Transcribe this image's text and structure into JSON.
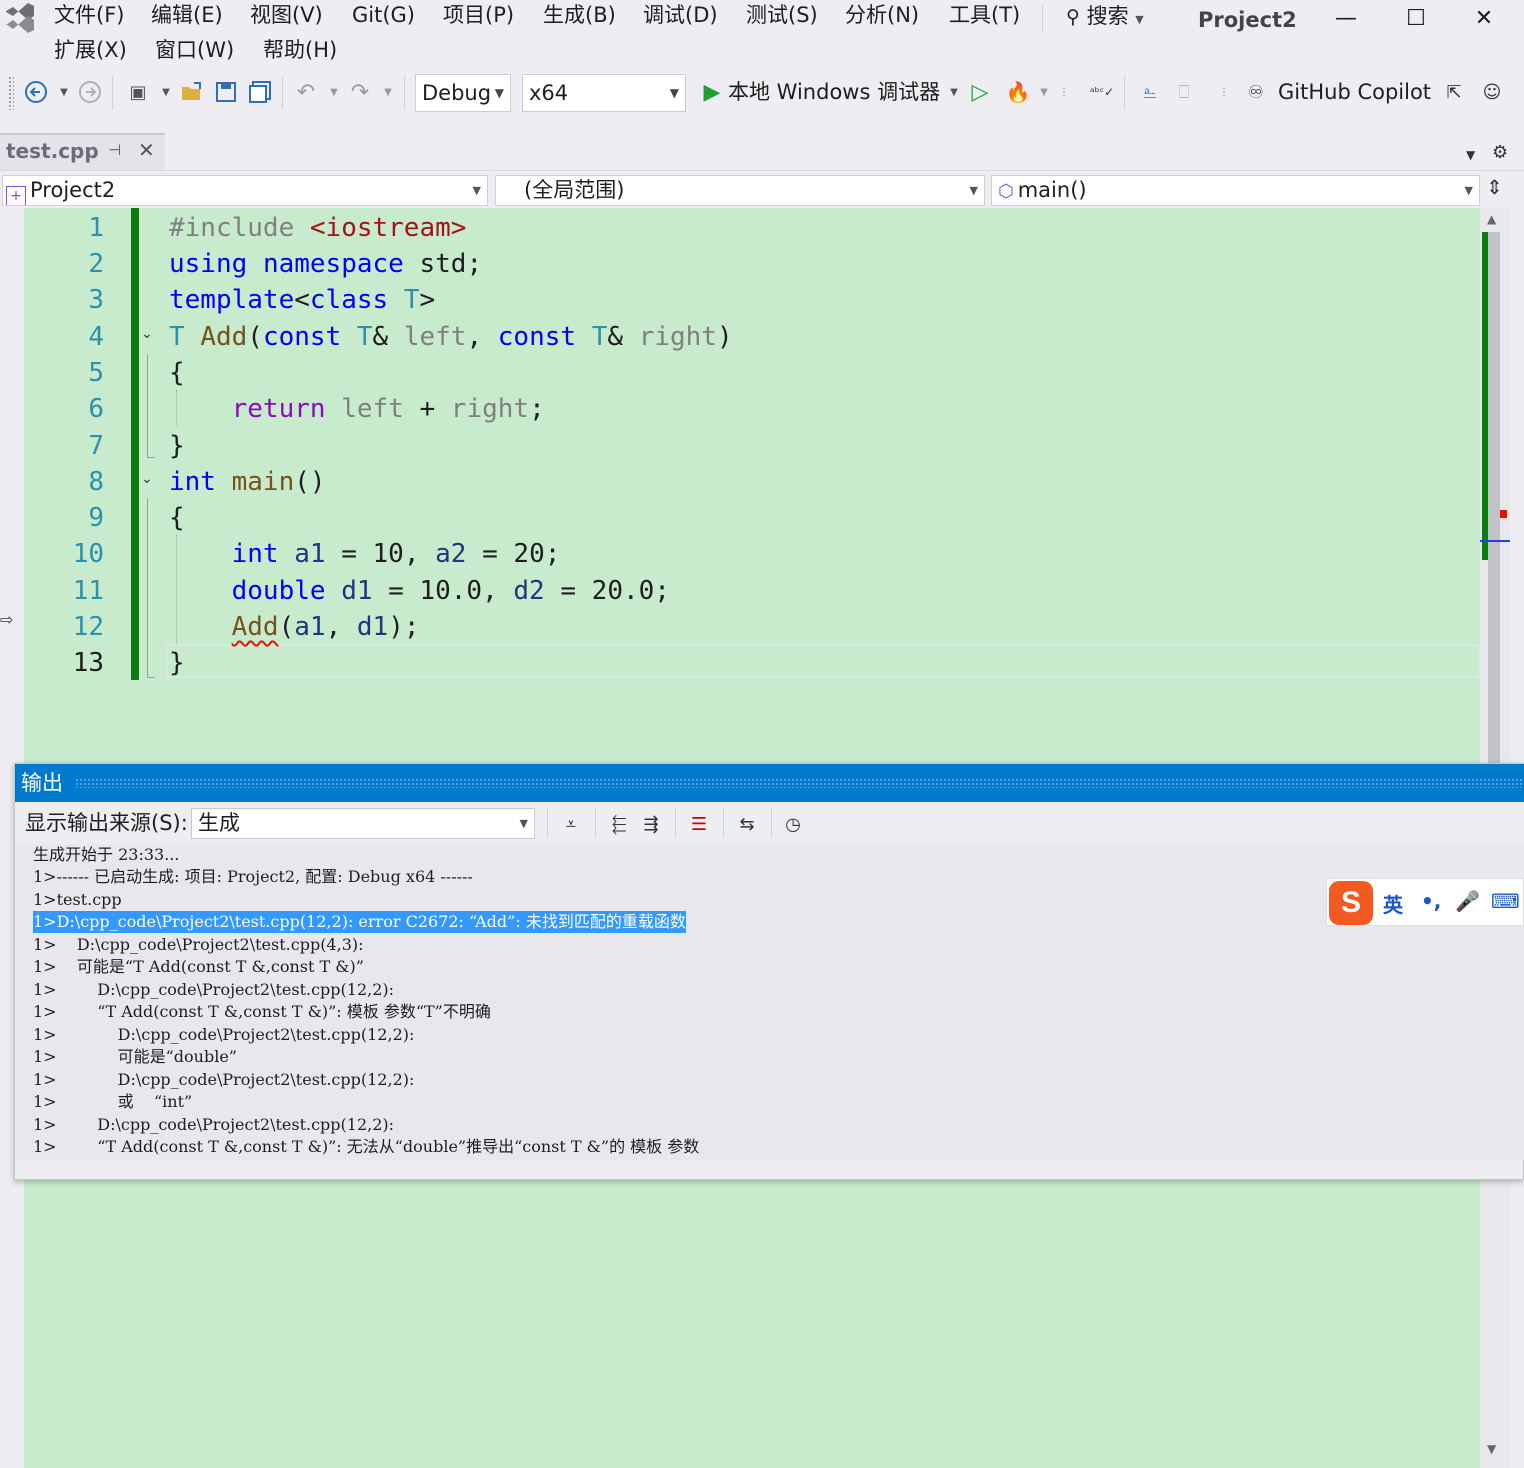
{
  "menu": {
    "row1": [
      "文件(F)",
      "编辑(E)",
      "视图(V)",
      "Git(G)",
      "项目(P)",
      "生成(B)",
      "调试(D)",
      "测试(S)",
      "分析(N)",
      "工具(T)"
    ],
    "row2": [
      "扩展(X)",
      "窗口(W)",
      "帮助(H)"
    ],
    "search_label": "搜索",
    "window_title": "Project2",
    "minimize": "—",
    "maximize": "☐",
    "close": "✕"
  },
  "toolbar": {
    "config": "Debug",
    "platform": "x64",
    "run_label": "本地 Windows 调试器",
    "copilot_label": "GitHub Copilot"
  },
  "tab": {
    "file_name": "test.cpp"
  },
  "navbar": {
    "project": "Project2",
    "scope": "(全局范围)",
    "member": "main()"
  },
  "editor": {
    "line_numbers": [
      "1",
      "2",
      "3",
      "4",
      "5",
      "6",
      "7",
      "8",
      "9",
      "10",
      "11",
      "12",
      "13"
    ],
    "current_line": 13
  },
  "output": {
    "title": "输出",
    "source_label": "显示输出来源(S):",
    "source_value": "生成",
    "lines": [
      "生成开始于 23:33...",
      "1>------ 已启动生成: 项目: Project2, 配置: Debug x64 ------",
      "1>test.cpp",
      "1>D:\\cpp_code\\Project2\\test.cpp(12,2): error C2672: “Add”: 未找到匹配的重载函数",
      "1>    D:\\cpp_code\\Project2\\test.cpp(4,3):",
      "1>    可能是“T Add(const T &,const T &)”",
      "1>        D:\\cpp_code\\Project2\\test.cpp(12,2):",
      "1>        “T Add(const T &,const T &)”: 模板 参数“T”不明确",
      "1>            D:\\cpp_code\\Project2\\test.cpp(12,2):",
      "1>            可能是“double”",
      "1>            D:\\cpp_code\\Project2\\test.cpp(12,2):",
      "1>            或    “int”",
      "1>        D:\\cpp_code\\Project2\\test.cpp(12,2):",
      "1>        “T Add(const T &,const T &)”: 无法从“double”推导出“const T &”的 模板 参数"
    ],
    "selected_line_index": 3
  },
  "ime": {
    "logo": "S",
    "mode": "英",
    "punct": "•,",
    "mic": "🎤",
    "keyboard": "⌨"
  }
}
